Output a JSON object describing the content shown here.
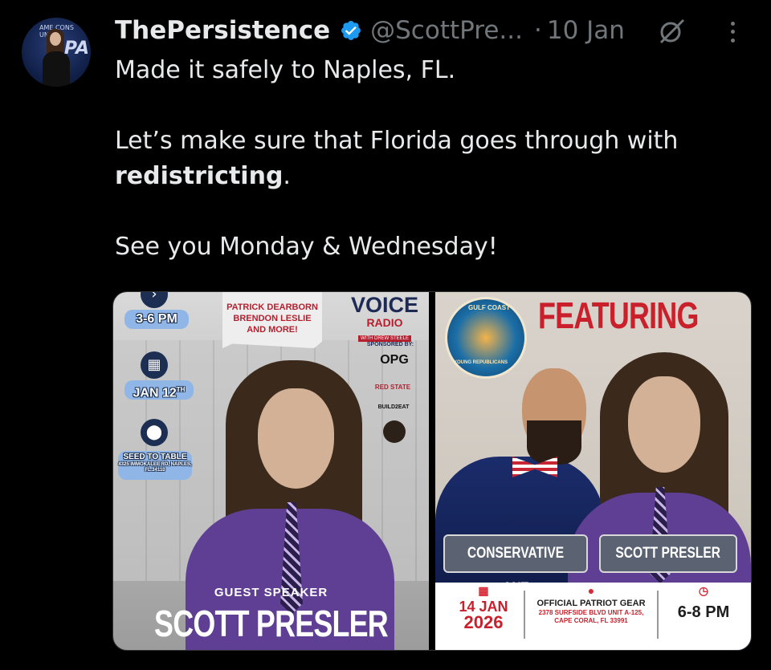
{
  "tweet": {
    "author_name": "ThePersistence",
    "handle": "@ScottPre...",
    "separator": "·",
    "time": "10 Jan",
    "text_line1": "Made it safely to Naples, FL.",
    "text_line2_prefix": "Let’s make sure that Florida goes through with",
    "text_bold": "redistricting",
    "text_line2_suffix": ".",
    "text_line3": "See you Monday & Wednesday!",
    "avatar_text": "AME CONS UNION",
    "avatar_logo": "PA"
  },
  "icons": {
    "verified": "verified-badge-icon",
    "grok": "grok-icon",
    "more": "more-options-icon"
  },
  "flyer1": {
    "time": "3-6 PM",
    "date": "JAN 12",
    "date_sup": "TH",
    "venue": "SEED TO TABLE",
    "address": "4325 IMMOKALEE RD, NAPLES, FL 34110",
    "featuring_names": [
      "PATRICK DEARBORN",
      "BRENDON LESLIE",
      "AND MORE!"
    ],
    "voice_line1": "VOICE",
    "voice_line2": "RADIO",
    "voice_line3": "WITH DREW STEELE",
    "sponsored_by": "SPONSORED BY:",
    "sponsor1": "OPG",
    "sponsor2": "RED STATE",
    "sponsor3": "BUILD2EAT",
    "guest_label": "GUEST SPEAKER",
    "guest_name": "SCOTT PRESLER"
  },
  "flyer2": {
    "heading": "FEATURING",
    "logo_top": "GULF COAST",
    "logo_bottom": "YOUNG REPUBLICANS",
    "label_left": "CONSERVATIVE ANT",
    "label_right": "SCOTT PRESLER",
    "date_line1": "14 JAN",
    "date_line2": "2026",
    "venue": "OFFICIAL PATRIOT GEAR",
    "address": "2378 SURFSIDE BLVD UNIT A-125, CAPE CORAL, FL 33991",
    "time": "6-8 PM"
  },
  "colors": {
    "background": "#000000",
    "text": "#e7e9ea",
    "muted": "#71767b",
    "verified": "#1d9bf0",
    "flyer_red": "#c9202b"
  }
}
